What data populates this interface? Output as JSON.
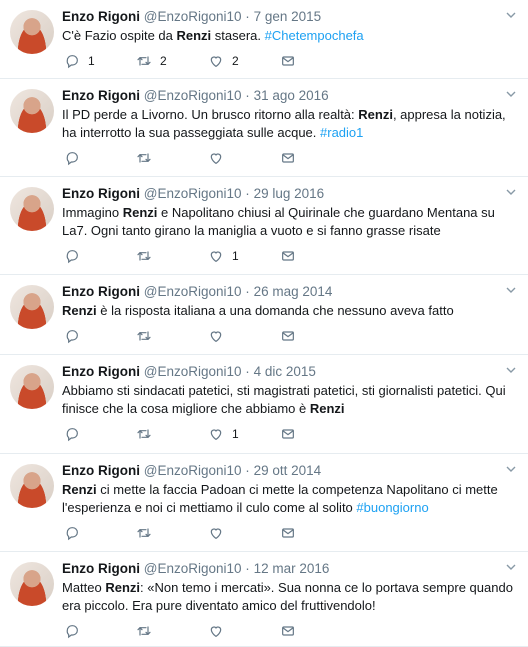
{
  "tweets": [
    {
      "name": "Enzo Rigoni",
      "handle": "@EnzoRigoni10",
      "date": "7 gen 2015",
      "parts": [
        {
          "t": "C'è Fazio ospite da "
        },
        {
          "t": "Renzi",
          "b": true
        },
        {
          "t": " stasera. "
        },
        {
          "t": "#Chetempochefa",
          "h": true
        }
      ],
      "counts": {
        "reply": "1",
        "retweet": "2",
        "like": "2"
      }
    },
    {
      "name": "Enzo Rigoni",
      "handle": "@EnzoRigoni10",
      "date": "31 ago 2016",
      "parts": [
        {
          "t": "Il PD perde a Livorno. Un brusco ritorno alla realtà: "
        },
        {
          "t": "Renzi",
          "b": true
        },
        {
          "t": ", appresa la notizia, ha interrotto la sua passeggiata sulle acque. "
        },
        {
          "t": "#radio1",
          "h": true
        }
      ],
      "counts": {
        "reply": "",
        "retweet": "",
        "like": ""
      }
    },
    {
      "name": "Enzo Rigoni",
      "handle": "@EnzoRigoni10",
      "date": "29 lug 2016",
      "parts": [
        {
          "t": "Immagino "
        },
        {
          "t": "Renzi",
          "b": true
        },
        {
          "t": " e Napolitano chiusi al Quirinale che guardano Mentana su La7. Ogni tanto girano la maniglia a vuoto e si fanno grasse risate"
        }
      ],
      "counts": {
        "reply": "",
        "retweet": "",
        "like": "1"
      }
    },
    {
      "name": "Enzo Rigoni",
      "handle": "@EnzoRigoni10",
      "date": "26 mag 2014",
      "parts": [
        {
          "t": "Renzi",
          "b": true
        },
        {
          "t": " è la risposta italiana a una domanda che nessuno aveva fatto"
        }
      ],
      "counts": {
        "reply": "",
        "retweet": "",
        "like": ""
      }
    },
    {
      "name": "Enzo Rigoni",
      "handle": "@EnzoRigoni10",
      "date": "4 dic 2015",
      "parts": [
        {
          "t": "Abbiamo sti sindacati patetici, sti magistrati patetici, sti giornalisti patetici. Qui finisce che la cosa migliore che abbiamo è "
        },
        {
          "t": "Renzi",
          "b": true
        }
      ],
      "counts": {
        "reply": "",
        "retweet": "",
        "like": "1"
      }
    },
    {
      "name": "Enzo Rigoni",
      "handle": "@EnzoRigoni10",
      "date": "29 ott 2014",
      "parts": [
        {
          "t": "Renzi",
          "b": true
        },
        {
          "t": " ci mette la faccia Padoan ci mette la competenza Napolitano ci mette l'esperienza e noi ci mettiamo il culo come al solito "
        },
        {
          "t": "#buongiorno",
          "h": true
        }
      ],
      "counts": {
        "reply": "",
        "retweet": "",
        "like": ""
      }
    },
    {
      "name": "Enzo Rigoni",
      "handle": "@EnzoRigoni10",
      "date": "12 mar 2016",
      "parts": [
        {
          "t": "Matteo "
        },
        {
          "t": "Renzi",
          "b": true
        },
        {
          "t": ": «Non temo i mercati». Sua nonna ce lo portava sempre quando era piccolo. Era pure diventato amico del fruttivendolo!"
        }
      ],
      "counts": {
        "reply": "",
        "retweet": "",
        "like": ""
      }
    }
  ],
  "separator": "·",
  "icons": {
    "reply": "reply-icon",
    "retweet": "retweet-icon",
    "like": "heart-icon",
    "message": "envelope-icon",
    "menu": "chevron-down-icon"
  },
  "colors": {
    "text": "#14171a",
    "muted": "#657786",
    "link": "#1da1f2",
    "border": "#e6ecf0"
  }
}
